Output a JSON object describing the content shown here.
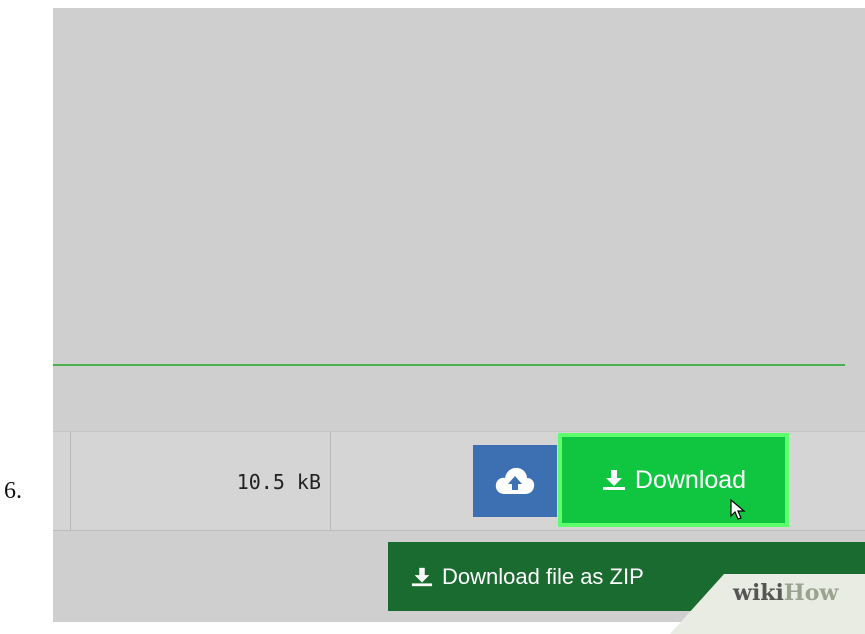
{
  "step": {
    "number": "6."
  },
  "file_row": {
    "size": "10.5 kB"
  },
  "buttons": {
    "upload_icon": "cloud-upload-icon",
    "download_label": "Download",
    "download_icon": "download-icon",
    "zip_label": "Download file as ZIP",
    "zip_icon": "download-icon"
  },
  "watermark": {
    "wiki": "wiki",
    "how": "How"
  },
  "colors": {
    "background": "#cfcfcf",
    "progress_line": "#4caf50",
    "upload_button": "#3d6fb3",
    "download_button": "#10c640",
    "download_highlight": "#5cff6c",
    "zip_button": "#1a6b2f"
  }
}
